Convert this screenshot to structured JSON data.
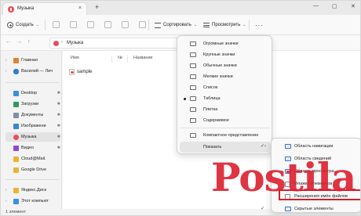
{
  "window": {
    "tab_title": "Музыка",
    "close_tab": "×",
    "new_tab": "+",
    "minimize": "—",
    "maximize": "▢",
    "close": "✕"
  },
  "toolbar": {
    "create_label": "Создать",
    "create_chevron": "⌄",
    "sort_label": "Сортировать",
    "sort_chevron": "⌄",
    "view_label": "Просмотреть",
    "view_chevron": "⌄",
    "more_label": "···"
  },
  "address": {
    "back": "←",
    "forward": "→",
    "up": "↑",
    "path_separator": "›",
    "path": "Музыка"
  },
  "sidebar": {
    "items": [
      {
        "label": "Главная",
        "chevron": "›",
        "pin": "",
        "icon": "home-icon",
        "color": "#e0832d"
      },
      {
        "label": "Василий — Лич",
        "chevron": "›",
        "pin": "",
        "icon": "cloud-icon",
        "color": "#2f7dd1"
      },
      {
        "label": "Desktop",
        "chevron": "",
        "pin": "✱",
        "icon": "desktop-icon",
        "color": "#3a8ee6"
      },
      {
        "label": "Загрузки",
        "chevron": "",
        "pin": "✱",
        "icon": "download-icon",
        "color": "#2a9d5a"
      },
      {
        "label": "Документы",
        "chevron": "",
        "pin": "✱",
        "icon": "document-icon",
        "color": "#7f8ea3"
      },
      {
        "label": "Изображени",
        "chevron": "",
        "pin": "✱",
        "icon": "image-icon",
        "color": "#3b83d6"
      },
      {
        "label": "Музыка",
        "chevron": "",
        "pin": "✱",
        "icon": "music-icon",
        "color": "#e84c5a"
      },
      {
        "label": "Видео",
        "chevron": "",
        "pin": "✱",
        "icon": "video-icon",
        "color": "#8e4bd3"
      },
      {
        "label": "Cloud@Mail.",
        "chevron": "",
        "pin": "",
        "icon": "folder-icon",
        "color": "#e7b531"
      },
      {
        "label": "Google Drive",
        "chevron": "",
        "pin": "",
        "icon": "folder-icon",
        "color": "#e7b531"
      },
      {
        "label": "Яндекс.Диск",
        "chevron": "›",
        "pin": "",
        "icon": "folder-icon",
        "color": "#e7b531"
      },
      {
        "label": "Этот компьют",
        "chevron": "›",
        "pin": "",
        "icon": "computer-icon",
        "color": "#3a8ee6"
      }
    ]
  },
  "content": {
    "columns": [
      "Имя",
      "№",
      "Название"
    ],
    "files": [
      {
        "name": "sample"
      }
    ]
  },
  "status": {
    "text": "1 элемент"
  },
  "view_menu": {
    "items": [
      {
        "label": "Огромные значки",
        "selected": false,
        "arrow": ""
      },
      {
        "label": "Крупные значки",
        "selected": false,
        "arrow": ""
      },
      {
        "label": "Обычные значки",
        "selected": false,
        "arrow": ""
      },
      {
        "label": "Мелкие значки",
        "selected": false,
        "arrow": ""
      },
      {
        "label": "Список",
        "selected": false,
        "arrow": ""
      },
      {
        "label": "Таблица",
        "selected": true,
        "arrow": ""
      },
      {
        "label": "Плитка",
        "selected": false,
        "arrow": ""
      },
      {
        "label": "Содержимое",
        "selected": false,
        "arrow": ""
      },
      {
        "label": "Компактное представление",
        "selected": false,
        "arrow": ""
      },
      {
        "label": "Показать",
        "selected": false,
        "arrow": "›"
      }
    ]
  },
  "show_submenu": {
    "items": [
      {
        "label": "Область навигации",
        "checked": true,
        "check": "✓"
      },
      {
        "label": "Область сведений",
        "checked": false,
        "check": ""
      },
      {
        "label": "Область просмотра",
        "checked": false,
        "check": ""
      },
      {
        "label": "Флажки элементов",
        "checked": false,
        "check": ""
      },
      {
        "label": "Расширения имён файлов",
        "checked": false,
        "check": ""
      },
      {
        "label": "Скрытые элементы",
        "checked": false,
        "check": "✓"
      }
    ]
  },
  "watermark": {
    "text": "Postila"
  },
  "accent": "#e84c5a"
}
